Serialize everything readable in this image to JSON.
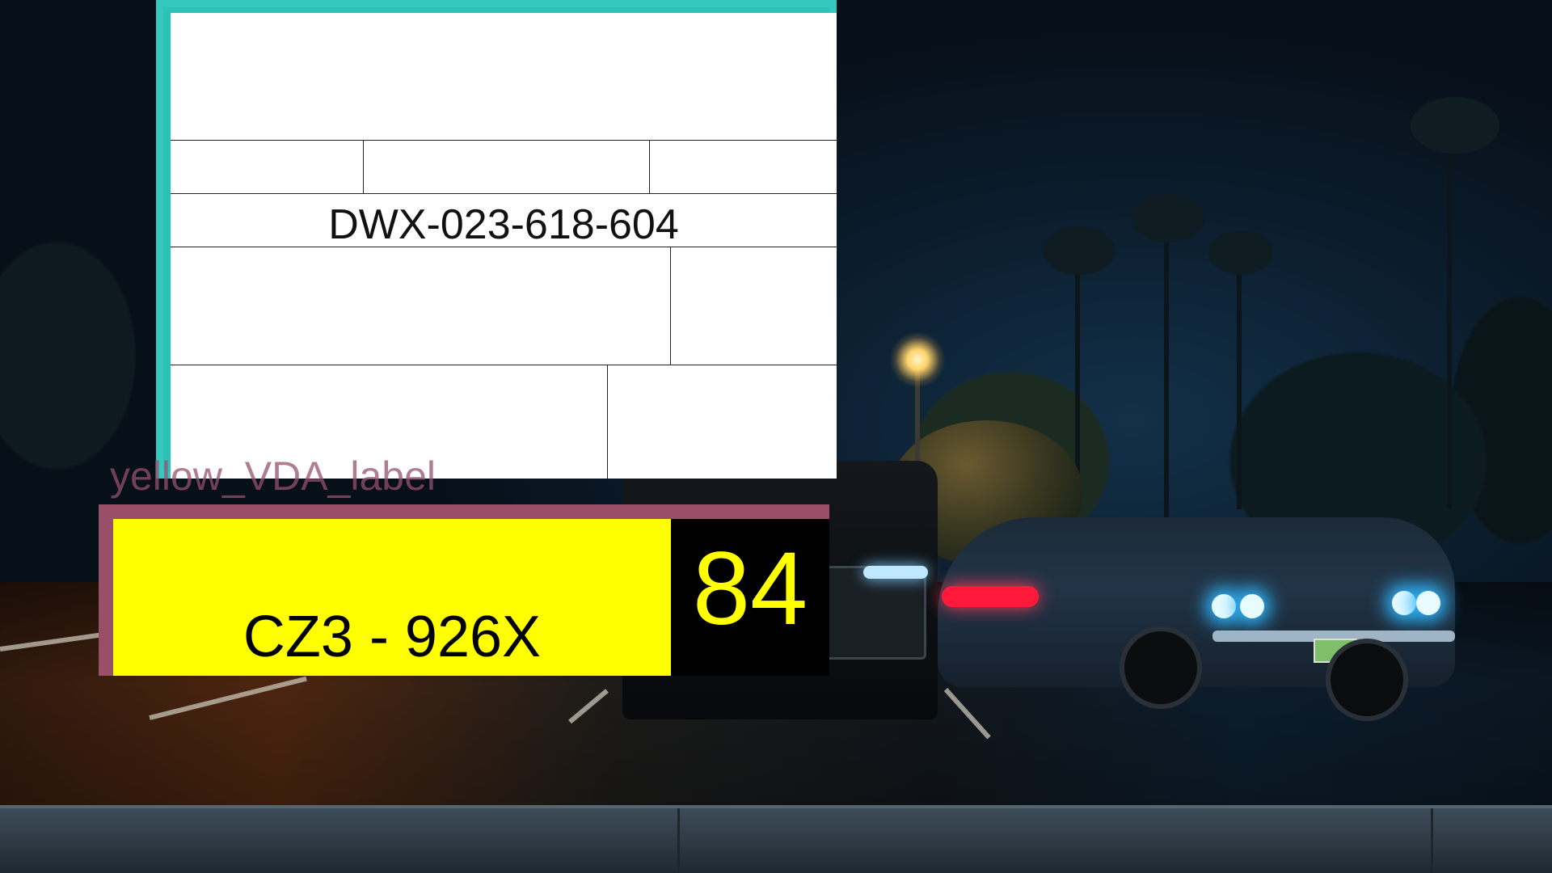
{
  "document_card": {
    "code": "DWX-023-618-604",
    "border_color": "#35c8be"
  },
  "overlay_label": {
    "text": "yellow_VDA_label",
    "color": "#9a4f68"
  },
  "vda_label": {
    "plate_text": "CZ3 - 926X",
    "number": "84",
    "background_color": "#ffff00",
    "number_color": "#ffff00",
    "frame_color": "#9a4f68"
  }
}
